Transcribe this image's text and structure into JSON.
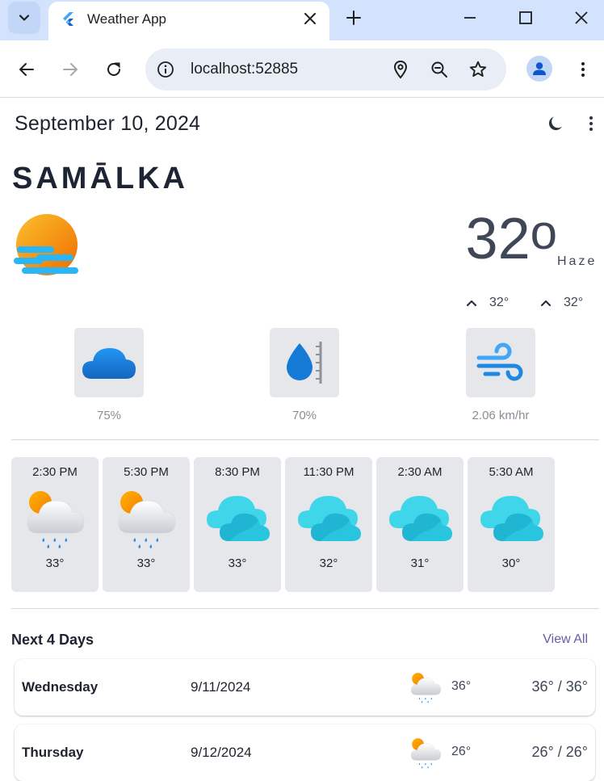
{
  "browser": {
    "tab_title": "Weather App",
    "url": "localhost:52885"
  },
  "app": {
    "date": "September 10, 2024",
    "city": "SAMĀLKA",
    "current": {
      "temperature": "32",
      "degree": "o",
      "condition": "Haze",
      "high": "32°",
      "low": "32°",
      "icon": "haze-sun-icon"
    },
    "stats": {
      "clouds": "75%",
      "humidity": "70%",
      "wind": "2.06 km/hr"
    },
    "hourly": [
      {
        "time": "2:30 PM",
        "temp": "33°",
        "icon": "sun-rain-cloud-icon"
      },
      {
        "time": "5:30 PM",
        "temp": "33°",
        "icon": "sun-rain-cloud-icon"
      },
      {
        "time": "8:30 PM",
        "temp": "33°",
        "icon": "cloud-icon"
      },
      {
        "time": "11:30 PM",
        "temp": "32°",
        "icon": "cloud-icon"
      },
      {
        "time": "2:30 AM",
        "temp": "31°",
        "icon": "cloud-icon"
      },
      {
        "time": "5:30 AM",
        "temp": "30°",
        "icon": "cloud-icon"
      }
    ],
    "next_days_title": "Next 4 Days",
    "view_all": "View All",
    "days": [
      {
        "name": "Wednesday",
        "date": "9/11/2024",
        "temp": "36°",
        "range": "36° / 36°",
        "icon": "sun-rain-cloud-icon"
      },
      {
        "name": "Thursday",
        "date": "9/12/2024",
        "temp": "26°",
        "range": "26° / 26°",
        "icon": "sun-rain-cloud-icon"
      }
    ]
  },
  "colors": {
    "tab_strip": "#d3e3fd",
    "card_bg": "#e6e7ea",
    "accent_link": "#6a5aa8",
    "cloud_blue": "#1e88e5",
    "cloud_cyan": "#3fd6ea",
    "sun_orange": "#f59b1b"
  }
}
